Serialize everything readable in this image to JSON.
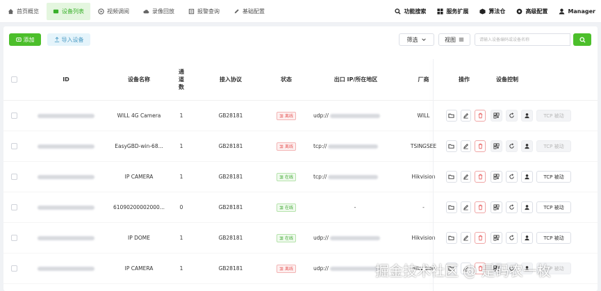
{
  "nav": {
    "tabs": [
      {
        "label": "首页概览",
        "icon": "home-icon"
      },
      {
        "label": "设备列表",
        "icon": "list-icon",
        "active": true
      },
      {
        "label": "视频调阅",
        "icon": "video-icon"
      },
      {
        "label": "录像回放",
        "icon": "cloud-icon"
      },
      {
        "label": "报警查询",
        "icon": "alarm-icon"
      },
      {
        "label": "基础配置",
        "icon": "edit-icon"
      }
    ],
    "right": [
      {
        "label": "功能搜索",
        "icon": "search-icon"
      },
      {
        "label": "服务扩展",
        "icon": "grid-icon"
      },
      {
        "label": "算法仓",
        "icon": "cube-icon"
      },
      {
        "label": "高级配置",
        "icon": "gear-icon"
      },
      {
        "label": "Manager",
        "icon": "user-icon"
      }
    ]
  },
  "toolbar": {
    "add_label": "添加",
    "import_label": "导入设备",
    "filter_label": "筛选",
    "view_label": "视图",
    "search_placeholder": "请输入设备编码或设备名称"
  },
  "table": {
    "headers": {
      "id": "ID",
      "name": "设备名称",
      "channels": "通道数",
      "protocol": "接入协议",
      "state": "状态",
      "address": "出口 IP/所在地区",
      "vendor": "厂商",
      "ops": "操作",
      "control": "设备控制"
    },
    "rows": [
      {
        "name": "WILL 4G Camera",
        "channels": "1",
        "protocol": "GB28181",
        "state": "离线",
        "online": false,
        "addr_prefix": "udp://",
        "vendor": "WILL",
        "tcp": "TCP 被动"
      },
      {
        "name": "EasyGBD-win-68...",
        "channels": "1",
        "protocol": "GB28181",
        "state": "离线",
        "online": false,
        "addr_prefix": "tcp://",
        "vendor": "TSINGSEE",
        "tcp": "TCP 被动"
      },
      {
        "name": "IP CAMERA",
        "channels": "1",
        "protocol": "GB28181",
        "state": "在线",
        "online": true,
        "addr_prefix": "tcp://",
        "vendor": "Hikvision",
        "tcp": "TCP 被动"
      },
      {
        "name": "61090200002000...",
        "channels": "0",
        "protocol": "GB28181",
        "state": "在线",
        "online": true,
        "addr_prefix": "-",
        "vendor": "-",
        "tcp": "TCP 被动"
      },
      {
        "name": "IP DOME",
        "channels": "1",
        "protocol": "GB28181",
        "state": "在线",
        "online": true,
        "addr_prefix": "udp://",
        "vendor": "Hikvision",
        "tcp": "TCP 被动"
      },
      {
        "name": "IP CAMERA",
        "channels": "1",
        "protocol": "GB28181",
        "state": "离线",
        "online": false,
        "addr_prefix": "udp://",
        "vendor": "Hikvision",
        "tcp": "TCP 被动"
      }
    ]
  },
  "watermark": "掘金技术社区 @ 是码农一枚",
  "colors": {
    "accent": "#4cbf2b",
    "offline": "#e65757",
    "online": "#3ea831"
  }
}
